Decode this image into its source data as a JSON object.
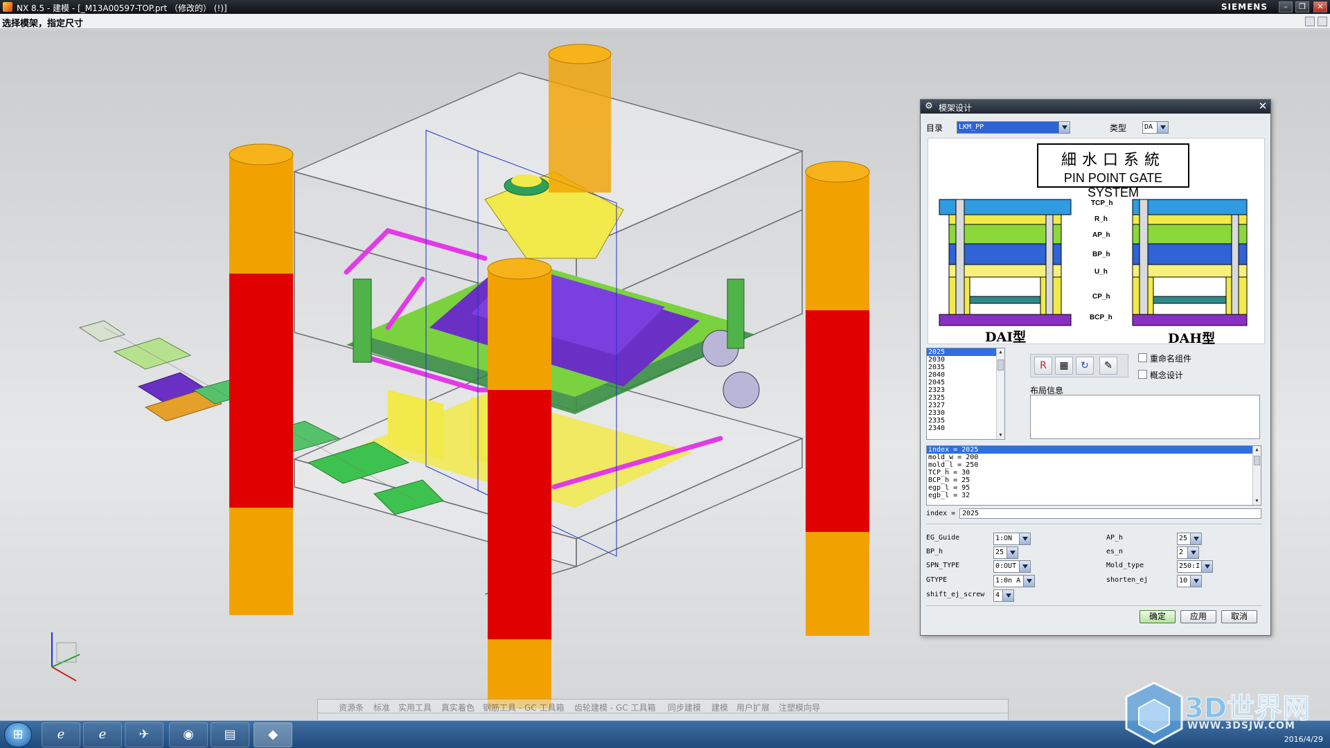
{
  "window": {
    "title": "NX 8.5 - 建模 - [_M13A00597-TOP.prt （修改的） (!)]",
    "brand": "SIEMENS",
    "cue": "选择模架，指定尺寸"
  },
  "dialog": {
    "title": "模架设计",
    "catalog_label": "目录",
    "catalog_value": "LKM_PP",
    "type_label": "类型",
    "type_value": "DA",
    "preview": {
      "title_cn": "細水口系統",
      "title_en": "PIN POINT GATE SYSTEM",
      "left_caption": "DAI型",
      "right_caption": "DAH型",
      "height_labels": [
        "TCP_h",
        "R_h",
        "AP_h",
        "BP_h",
        "U_h",
        "CP_h",
        "BCP_h"
      ]
    },
    "size_list": [
      "2025",
      "2030",
      "2035",
      "2040",
      "2045",
      "2323",
      "2325",
      "2327",
      "2330",
      "2335",
      "2340"
    ],
    "size_selected": "2025",
    "rename_component_label": "重命名组件",
    "concept_design_label": "概念设计",
    "layout_info_label": "布局信息",
    "expressions": [
      "index = 2025",
      "mold_w = 200",
      "mold_l = 250",
      "TCP_h = 30",
      "BCP_h = 25",
      "egp_l = 95",
      "egb_l = 32"
    ],
    "expression_input": "2025",
    "expression_input_label": "index =",
    "params_left": [
      {
        "name": "EG_Guide",
        "value": "1:ON"
      },
      {
        "name": "BP_h",
        "value": "25"
      },
      {
        "name": "SPN_TYPE",
        "value": "0:OUT"
      },
      {
        "name": "GTYPE",
        "value": "1:0n A"
      },
      {
        "name": "shift_ej_screw",
        "value": "4"
      }
    ],
    "params_right": [
      {
        "name": "AP_h",
        "value": "25"
      },
      {
        "name": "es_n",
        "value": "2"
      },
      {
        "name": "Mold_type",
        "value": "250:I"
      },
      {
        "name": "shorten_ej",
        "value": "10"
      }
    ],
    "buttons": {
      "ok": "确定",
      "apply": "应用",
      "cancel": "取消"
    }
  },
  "resource_bar": {
    "tabs": [
      "资源条",
      "标准",
      "实用工具",
      "真实着色",
      "钢筋工具 - GC 工具箱",
      "齿轮建模 - GC 工具箱",
      "同步建模",
      "建模",
      "用户扩展",
      "注塑模向导"
    ]
  },
  "taskbar": {
    "date": "2016/4/29"
  },
  "watermark": {
    "text": "3D世界网",
    "url": "WWW.3DSJW.COM"
  },
  "colors": {
    "pillar_orange": "#f2a200",
    "pillar_red": "#e10000",
    "plate_blue": "#2f63d6",
    "plate_yellow": "#f2e94a",
    "plate_green": "#7ad23e",
    "plate_purple": "#6a2fc4",
    "pipe_magenta": "#e23ae6"
  }
}
